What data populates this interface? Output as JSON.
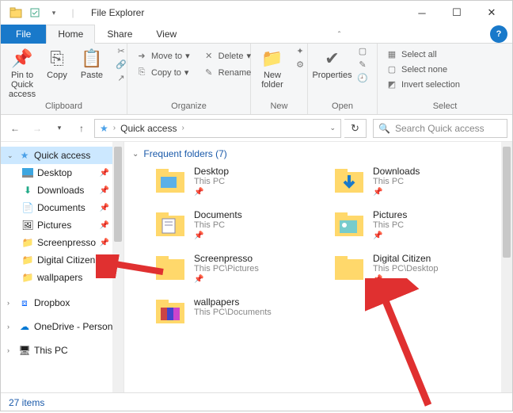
{
  "title": "File Explorer",
  "tabs": {
    "file": "File",
    "home": "Home",
    "share": "Share",
    "view": "View"
  },
  "ribbon": {
    "clipboard": {
      "pin": "Pin to Quick access",
      "copy": "Copy",
      "paste": "Paste",
      "label": "Clipboard"
    },
    "organize": {
      "moveto": "Move to",
      "copyto": "Copy to",
      "delete": "Delete",
      "rename": "Rename",
      "label": "Organize"
    },
    "new": {
      "newfolder": "New folder",
      "label": "New"
    },
    "open": {
      "properties": "Properties",
      "label": "Open"
    },
    "select": {
      "all": "Select all",
      "none": "Select none",
      "invert": "Invert selection",
      "label": "Select"
    }
  },
  "address": {
    "root": "Quick access"
  },
  "search": {
    "placeholder": "Search Quick access"
  },
  "sidebar": {
    "items": [
      {
        "label": "Quick access"
      },
      {
        "label": "Desktop"
      },
      {
        "label": "Downloads"
      },
      {
        "label": "Documents"
      },
      {
        "label": "Pictures"
      },
      {
        "label": "Screenpresso"
      },
      {
        "label": "Digital Citizen"
      },
      {
        "label": "wallpapers"
      },
      {
        "label": "Dropbox"
      },
      {
        "label": "OneDrive - Person"
      },
      {
        "label": "This PC"
      }
    ]
  },
  "content": {
    "header": "Frequent folders (7)",
    "folders": [
      {
        "name": "Desktop",
        "path": "This PC"
      },
      {
        "name": "Downloads",
        "path": "This PC"
      },
      {
        "name": "Documents",
        "path": "This PC"
      },
      {
        "name": "Pictures",
        "path": "This PC"
      },
      {
        "name": "Screenpresso",
        "path": "This PC\\Pictures"
      },
      {
        "name": "Digital Citizen",
        "path": "This PC\\Desktop"
      },
      {
        "name": "wallpapers",
        "path": "This PC\\Documents"
      }
    ]
  },
  "status": "27 items"
}
